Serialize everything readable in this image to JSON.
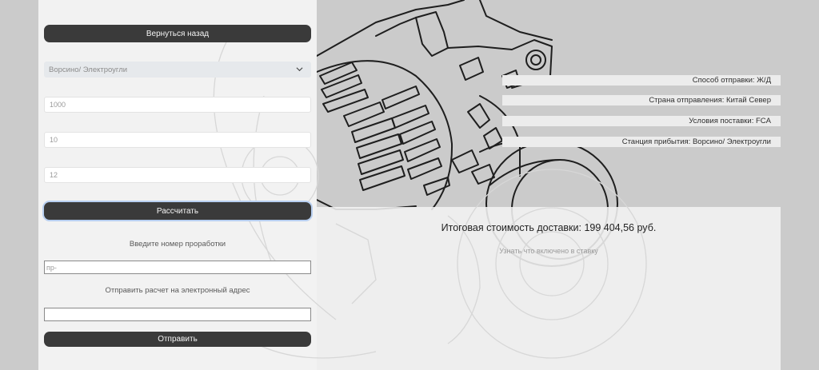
{
  "form": {
    "back_label": "Вернуться назад",
    "station_select": {
      "selected": "Ворсино/ Электроугли"
    },
    "inputs": [
      {
        "value": "1000"
      },
      {
        "value": "10"
      },
      {
        "value": "12"
      }
    ],
    "calculate_label": "Рассчитать",
    "study_number": {
      "label": "Введите номер проработки",
      "value": "пр-"
    },
    "email": {
      "label": "Отправить расчет на электронный адрес",
      "value": ""
    },
    "send_label": "Отправить"
  },
  "summary": {
    "rows": [
      "Способ отправки: Ж/Д",
      "Страна отправления: Китай Север",
      "Условия поставки: FCA",
      "Станция прибытия: Ворсино/ Электроугли"
    ]
  },
  "result": {
    "total": "Итоговая стоимость доставки: 199 404,56 руб.",
    "included_link": "Узнать что включено в ставку"
  },
  "colors": {
    "page_bg": "#cbcbcb",
    "panel_bg": "#f2f2f2",
    "button_bg": "#3a3a3a",
    "button_text": "#f4f4f4",
    "focus_ring": "#b8cff0"
  },
  "icons": {
    "select_arrow": "chevron-down-icon",
    "background": "alternator-drawing"
  }
}
